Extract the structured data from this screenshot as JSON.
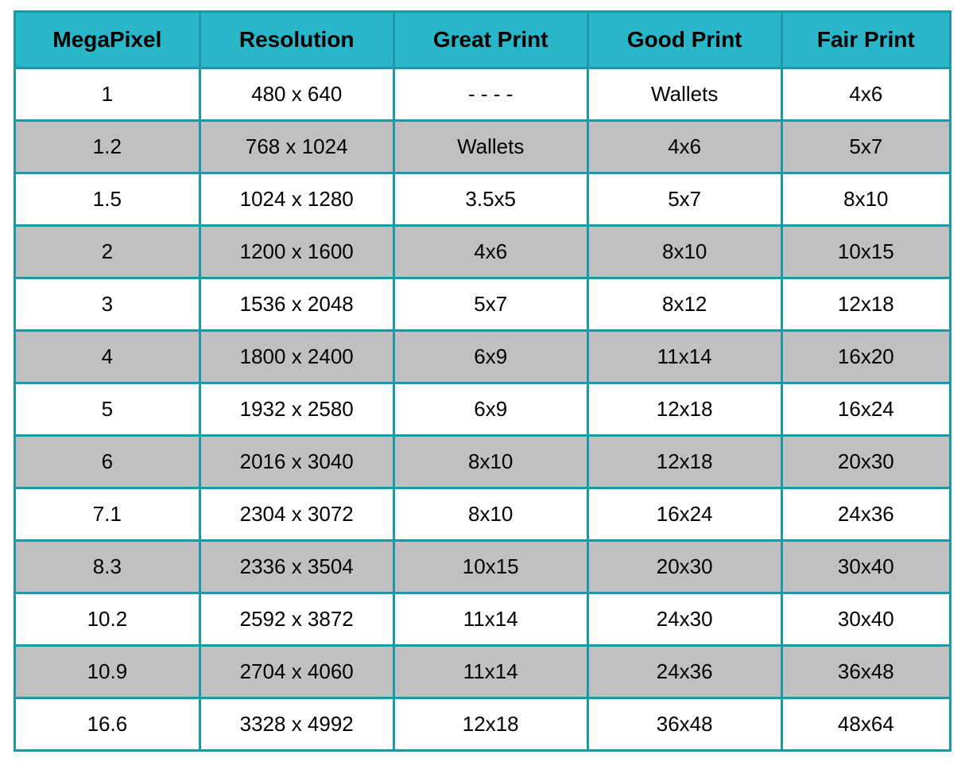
{
  "table": {
    "headers": [
      "MegaPixel",
      "Resolution",
      "Great Print",
      "Good Print",
      "Fair Print"
    ],
    "rows": [
      {
        "megapixel": "1",
        "resolution": "480 x 640",
        "great": "- - - -",
        "good": "Wallets",
        "fair": "4x6"
      },
      {
        "megapixel": "1.2",
        "resolution": "768 x 1024",
        "great": "Wallets",
        "good": "4x6",
        "fair": "5x7"
      },
      {
        "megapixel": "1.5",
        "resolution": "1024 x 1280",
        "great": "3.5x5",
        "good": "5x7",
        "fair": "8x10"
      },
      {
        "megapixel": "2",
        "resolution": "1200 x 1600",
        "great": "4x6",
        "good": "8x10",
        "fair": "10x15"
      },
      {
        "megapixel": "3",
        "resolution": "1536 x 2048",
        "great": "5x7",
        "good": "8x12",
        "fair": "12x18"
      },
      {
        "megapixel": "4",
        "resolution": "1800 x 2400",
        "great": "6x9",
        "good": "11x14",
        "fair": "16x20"
      },
      {
        "megapixel": "5",
        "resolution": "1932 x 2580",
        "great": "6x9",
        "good": "12x18",
        "fair": "16x24"
      },
      {
        "megapixel": "6",
        "resolution": "2016 x 3040",
        "great": "8x10",
        "good": "12x18",
        "fair": "20x30"
      },
      {
        "megapixel": "7.1",
        "resolution": "2304 x 3072",
        "great": "8x10",
        "good": "16x24",
        "fair": "24x36"
      },
      {
        "megapixel": "8.3",
        "resolution": "2336 x 3504",
        "great": "10x15",
        "good": "20x30",
        "fair": "30x40"
      },
      {
        "megapixel": "10.2",
        "resolution": "2592 x 3872",
        "great": "11x14",
        "good": "24x30",
        "fair": "30x40"
      },
      {
        "megapixel": "10.9",
        "resolution": "2704 x 4060",
        "great": "11x14",
        "good": "24x36",
        "fair": "36x48"
      },
      {
        "megapixel": "16.6",
        "resolution": "3328 x 4992",
        "great": "12x18",
        "good": "36x48",
        "fair": "48x64"
      }
    ]
  }
}
